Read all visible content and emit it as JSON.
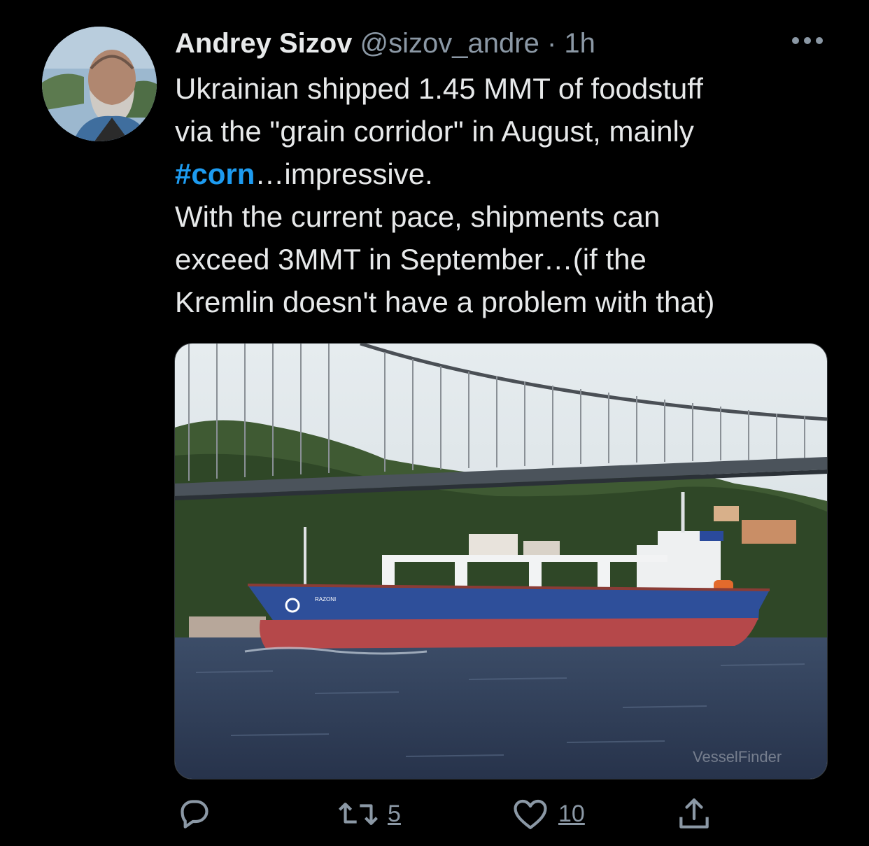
{
  "tweet": {
    "author": {
      "name": "Andrey Sizov",
      "handle": "@sizov_andre",
      "separator": "·",
      "time": "1h"
    },
    "more_icon": "more-horizontal-icon",
    "text": {
      "line1": "Ukrainian shipped 1.45 MMT of foodstuff",
      "line2": "via the \"grain corridor\" in August, mainly",
      "hashtag": "#corn",
      "line3_rest": "…impressive.",
      "line4": "With the current pace, shipments can",
      "line5": "exceed 3MMT in September…(if the",
      "line6": "Kremlin doesn't have a problem with that)"
    },
    "media": {
      "ship_name": "RAZONI",
      "watermark": "VesselFinder"
    },
    "actions": {
      "reply_icon": "reply-icon",
      "retweet_icon": "retweet-icon",
      "retweet_count": "5",
      "like_icon": "heart-icon",
      "like_count": "10",
      "share_icon": "share-icon"
    },
    "colors": {
      "background": "#000000",
      "text": "#e7e9ea",
      "secondary": "#8b98a5",
      "accent": "#1d9bf0"
    }
  }
}
